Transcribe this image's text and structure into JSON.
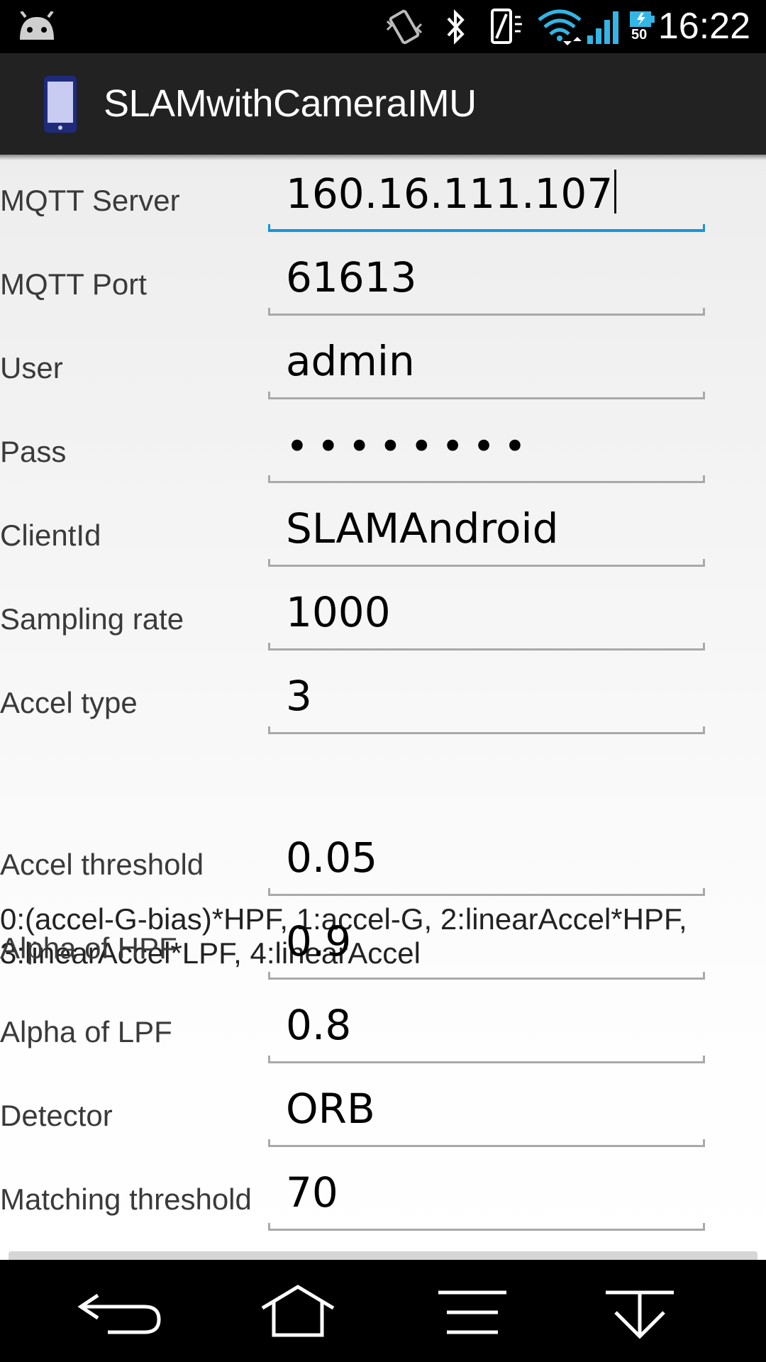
{
  "status_bar": {
    "time": "16:22",
    "battery_level": "50",
    "icons": [
      "android-debug-icon",
      "vibrate-icon",
      "bluetooth-icon",
      "nfc-icon",
      "wifi-icon",
      "signal-icon",
      "battery-icon"
    ]
  },
  "action_bar": {
    "title": "SLAMwithCameraIMU",
    "icon": "phone-app-icon"
  },
  "fields": [
    {
      "label": "MQTT Server",
      "value": "160.16.111.107"
    },
    {
      "label": "MQTT Port",
      "value": "61613"
    },
    {
      "label": "User",
      "value": "admin"
    },
    {
      "label": "Pass",
      "value": "••••••••"
    },
    {
      "label": "ClientId",
      "value": "SLAMAndroid"
    },
    {
      "label": "Sampling rate",
      "value": "1000"
    },
    {
      "label": "Accel type",
      "value": "3"
    },
    {
      "label": "Accel threshold",
      "value": "0.05"
    },
    {
      "label": "Alpha of HPF",
      "value": "0.9"
    },
    {
      "label": "Alpha of LPF",
      "value": "0.8"
    },
    {
      "label": "Detector",
      "value": "ORB"
    },
    {
      "label": "Matching threshold",
      "value": "70"
    }
  ],
  "accel_type_help": {
    "line1": "0:(accel-G-bias)*HPF, 1:accel-G, 2:linearAccel*HPF,",
    "line2": "3:linearAccel*LPF, 4:linearAccel"
  },
  "nav_bar": {
    "icons": [
      "back-icon",
      "home-icon",
      "menu-icon",
      "hide-keyboard-icon"
    ]
  },
  "colors": {
    "focus_accent": "#1596d8",
    "action_bar": "#222222",
    "signal": "#33b5e5"
  }
}
